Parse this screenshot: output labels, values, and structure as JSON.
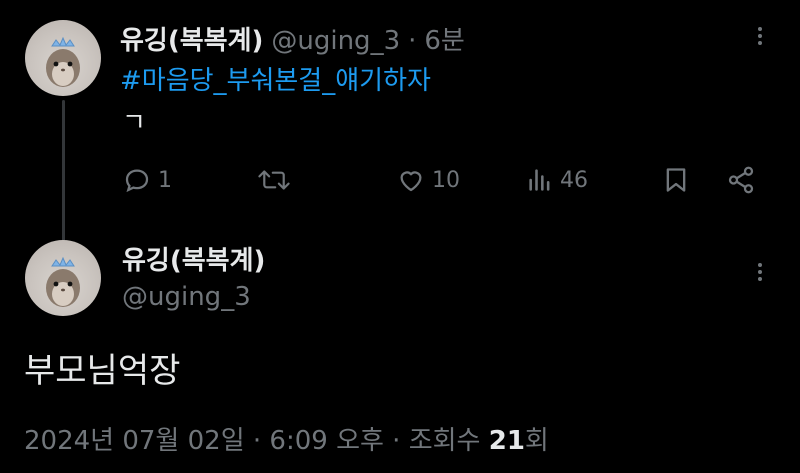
{
  "reply": {
    "display_name": "유깅(복복계)",
    "handle": "@uging_3",
    "separator": "·",
    "time_ago": "6분",
    "hashtag": "#마음당_부숴본걸_얘기하자",
    "text": "ㄱ",
    "actions": {
      "reply_count": "1",
      "like_count": "10",
      "view_count": "46"
    }
  },
  "main": {
    "display_name": "유깅(복복계)",
    "handle": "@uging_3",
    "text": "부모님억장",
    "meta": {
      "date_time": "2024년 07월 02일 · 6:09 오후 · 조회수 ",
      "views": "21",
      "views_suffix": "회"
    }
  },
  "icons": [
    "reply-icon",
    "retweet-icon",
    "like-icon",
    "views-icon",
    "bookmark-icon",
    "share-icon",
    "more-icon",
    "avatar-hamster"
  ]
}
